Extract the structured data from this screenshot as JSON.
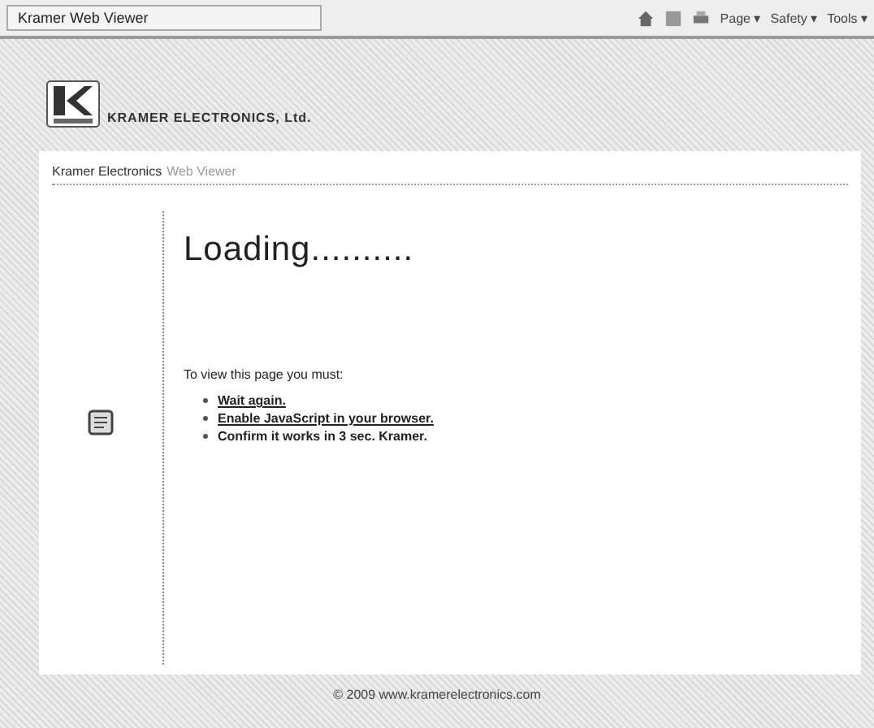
{
  "browser": {
    "tab_title": "Kramer Web Viewer",
    "toolbar": [
      "Page ▾",
      "Safety ▾",
      "Tools ▾"
    ]
  },
  "header": {
    "company": "KRAMER ELECTRONICS, Ltd."
  },
  "breadcrumb": [
    "Kramer Electronics",
    "Web Viewer"
  ],
  "main": {
    "heading": "Loading..........",
    "intro": "To view this page you must:",
    "steps": [
      {
        "text": "Wait again.",
        "link": true
      },
      {
        "text": "Enable JavaScript in your browser.",
        "link": true
      },
      {
        "text": "Confirm it works in 3 sec. Kramer.",
        "link": false
      }
    ]
  },
  "footer": "© 2009 www.kramerelectronics.com"
}
